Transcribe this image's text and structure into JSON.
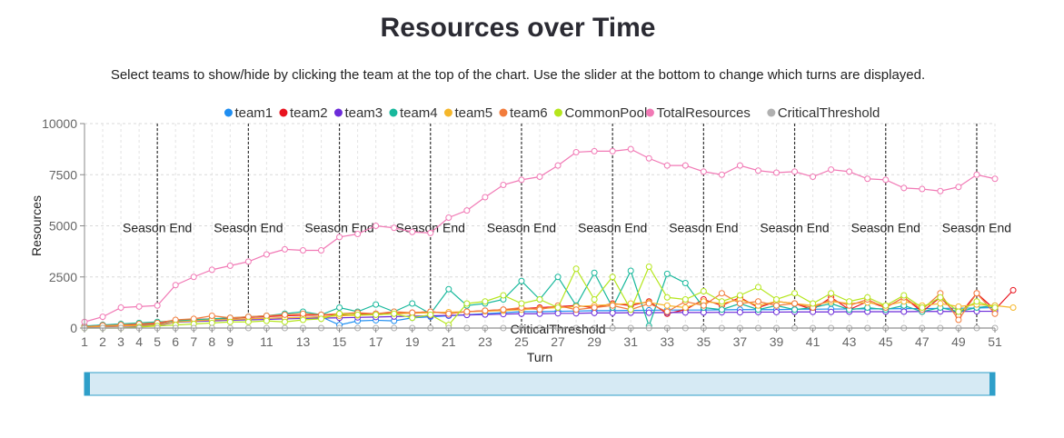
{
  "title": "Resources over Time",
  "subtitle": "Select teams to show/hide by clicking the team at the top of the chart. Use the slider at the bottom to change which turns are displayed.",
  "chart_data": {
    "type": "line",
    "xlabel": "Turn",
    "ylabel": "Resources",
    "xlim": [
      1,
      51
    ],
    "ylim": [
      0,
      10000
    ],
    "yticks": [
      0,
      2500,
      5000,
      7500,
      10000
    ],
    "ytick_labels": [
      "0",
      "2500",
      "5000",
      "7500",
      "10000"
    ],
    "xticks": [
      1,
      2,
      3,
      4,
      5,
      6,
      7,
      8,
      9,
      11,
      13,
      15,
      17,
      19,
      21,
      23,
      25,
      27,
      29,
      31,
      33,
      35,
      37,
      39,
      41,
      43,
      45,
      47,
      49,
      51
    ],
    "grid": true,
    "legend_position": "top",
    "season_end_turns": [
      5,
      10,
      15,
      20,
      25,
      30,
      35,
      40,
      45,
      50
    ],
    "season_end_label": "Season End",
    "critical_threshold_label": "CriticalThreshold",
    "series": [
      {
        "name": "team1",
        "color": "#1f8ef1",
        "values": [
          60,
          80,
          100,
          150,
          180,
          300,
          350,
          400,
          420,
          450,
          480,
          500,
          520,
          550,
          150,
          350,
          380,
          350,
          500,
          550,
          600,
          650,
          700,
          750,
          800,
          800,
          820,
          830,
          850,
          850,
          860,
          870,
          880,
          880,
          880,
          890,
          900,
          900,
          900,
          920,
          920,
          930,
          930,
          940,
          940,
          950,
          950,
          960,
          970,
          980,
          1000
        ]
      },
      {
        "name": "team2",
        "color": "#e8141f",
        "values": [
          80,
          150,
          120,
          180,
          220,
          380,
          420,
          450,
          480,
          520,
          560,
          600,
          620,
          640,
          650,
          680,
          700,
          720,
          750,
          800,
          720,
          800,
          850,
          900,
          950,
          1000,
          1050,
          1100,
          1000,
          1200,
          1100,
          1300,
          700,
          900,
          1400,
          1100,
          1500,
          1000,
          1300,
          1200,
          900,
          1500,
          900,
          1300,
          1000,
          1500,
          800,
          1500,
          600,
          1700,
          900,
          1850
        ]
      },
      {
        "name": "team3",
        "color": "#6c2bd9",
        "values": [
          50,
          60,
          80,
          90,
          120,
          280,
          320,
          350,
          380,
          400,
          420,
          450,
          470,
          490,
          500,
          520,
          540,
          560,
          580,
          600,
          620,
          640,
          660,
          680,
          700,
          700,
          720,
          720,
          740,
          740,
          750,
          750,
          760,
          760,
          760,
          770,
          770,
          780,
          780,
          790,
          790,
          790,
          800,
          800,
          800,
          800,
          810,
          810,
          810,
          820,
          820
        ]
      },
      {
        "name": "team4",
        "color": "#18b89c",
        "values": [
          100,
          150,
          200,
          250,
          300,
          350,
          400,
          450,
          500,
          550,
          600,
          700,
          800,
          650,
          1000,
          800,
          1150,
          800,
          1200,
          700,
          1900,
          1100,
          1200,
          1400,
          2300,
          1400,
          2500,
          1100,
          2700,
          1000,
          2800,
          100,
          2650,
          2200,
          1000,
          900,
          1200,
          900,
          1100,
          900,
          1000,
          1200,
          900,
          1000,
          900,
          1100,
          800,
          1000,
          800,
          1000,
          1100
        ]
      },
      {
        "name": "team5",
        "color": "#f5b72b",
        "values": [
          50,
          80,
          100,
          120,
          150,
          300,
          350,
          400,
          420,
          450,
          480,
          500,
          520,
          550,
          600,
          620,
          650,
          700,
          720,
          750,
          780,
          800,
          820,
          850,
          900,
          950,
          1000,
          1050,
          1100,
          1150,
          1200,
          1250,
          1100,
          1000,
          1300,
          1200,
          1400,
          1100,
          1300,
          1200,
          1100,
          1300,
          1200,
          1250,
          1100,
          1300,
          1100,
          1200,
          1050,
          1150,
          1100,
          1000
        ]
      },
      {
        "name": "team6",
        "color": "#f27c3c",
        "values": [
          70,
          120,
          150,
          200,
          250,
          400,
          450,
          600,
          500,
          550,
          600,
          650,
          700,
          650,
          700,
          750,
          700,
          800,
          750,
          800,
          700,
          800,
          850,
          900,
          1000,
          900,
          1100,
          900,
          1000,
          1100,
          900,
          1200,
          800,
          1300,
          1100,
          1700,
          1200,
          1300,
          1100,
          1200,
          1000,
          1400,
          1100,
          1400,
          1000,
          1500,
          900,
          1700,
          400,
          1700,
          700
        ]
      },
      {
        "name": "CommonPool",
        "color": "#b5e61d",
        "values": [
          0,
          0,
          0,
          50,
          100,
          150,
          200,
          250,
          300,
          300,
          350,
          300,
          400,
          450,
          700,
          650,
          650,
          700,
          500,
          650,
          150,
          1200,
          1300,
          1600,
          1200,
          1400,
          1000,
          2900,
          1400,
          2500,
          900,
          3000,
          1500,
          1400,
          1800,
          1300,
          1600,
          2000,
          1400,
          1700,
          1200,
          1700,
          1300,
          1500,
          1100,
          1600,
          1000,
          1500,
          800,
          1300,
          1000
        ]
      },
      {
        "name": "TotalResources",
        "color": "#f179b5",
        "values": [
          300,
          550,
          1000,
          1050,
          1100,
          2100,
          2500,
          2850,
          3050,
          3250,
          3600,
          3850,
          3800,
          3800,
          4450,
          4600,
          5000,
          4900,
          4700,
          4650,
          5400,
          5750,
          6400,
          7000,
          7250,
          7400,
          7950,
          8600,
          8650,
          8650,
          8750,
          8300,
          7950,
          7950,
          7650,
          7500,
          7950,
          7700,
          7600,
          7650,
          7400,
          7750,
          7650,
          7300,
          7250,
          6850,
          6800,
          6700,
          6900,
          7500,
          7300
        ]
      },
      {
        "name": "CriticalThreshold",
        "color": "#b0b0b0",
        "values": [
          0,
          0,
          0,
          0,
          0,
          0,
          0,
          0,
          0,
          0,
          0,
          0,
          0,
          0,
          0,
          0,
          0,
          0,
          0,
          0,
          0,
          0,
          0,
          0,
          0,
          0,
          0,
          0,
          0,
          0,
          0,
          0,
          0,
          0,
          0,
          0,
          0,
          0,
          0,
          0,
          0,
          0,
          0,
          0,
          0,
          0,
          0,
          0,
          0,
          0,
          0
        ]
      }
    ]
  },
  "slider": {
    "color": "#2f9fc9",
    "fill": "#d6eaf4",
    "range": [
      1,
      51
    ]
  }
}
